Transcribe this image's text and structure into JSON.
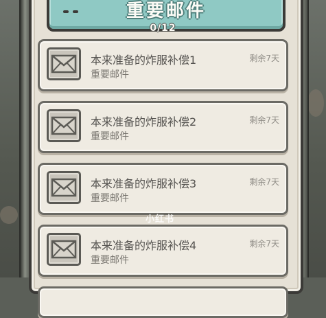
{
  "header": {
    "title": "重要邮件",
    "counter": "0/12"
  },
  "mails": [
    {
      "title": "本来准备的炸服补偿1",
      "category": "重要邮件",
      "remaining": "剩余7天",
      "icon": "envelope-icon"
    },
    {
      "title": "本来准备的炸服补偿2",
      "category": "重要邮件",
      "remaining": "剩余7天",
      "icon": "envelope-icon"
    },
    {
      "title": "本来准备的炸服补偿3",
      "category": "重要邮件",
      "remaining": "剩余7天",
      "icon": "envelope-icon"
    },
    {
      "title": "本来准备的炸服补偿4",
      "category": "重要邮件",
      "remaining": "剩余7天",
      "icon": "envelope-icon"
    }
  ],
  "watermark": "小红书",
  "colors": {
    "header": "#8fc9c4",
    "paper": "#e6e1d6",
    "card": "#efebe2",
    "border": "#3b3a37"
  }
}
